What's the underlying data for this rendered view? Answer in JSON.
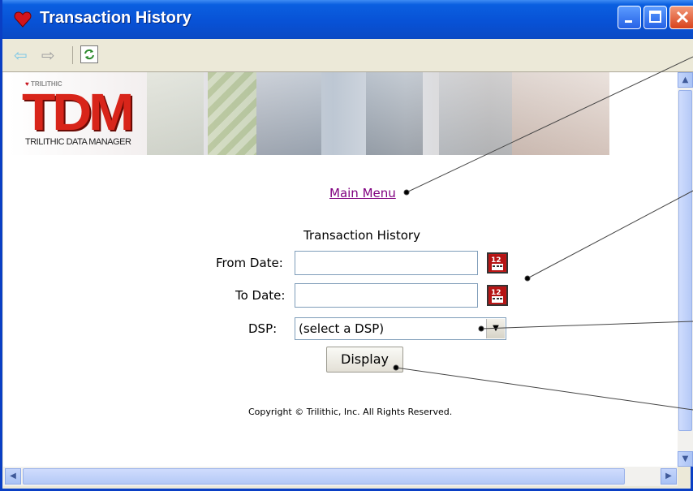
{
  "window": {
    "title": "Transaction History"
  },
  "toolbar": {
    "back": "⇦",
    "forward": "⇨"
  },
  "banner": {
    "brand_small": "TRILITHIC",
    "logo": "TDM",
    "logo_sub": "TRILITHIC DATA MANAGER"
  },
  "main": {
    "main_menu_link": "Main Menu",
    "form_title": "Transaction History",
    "from_label": "From Date:",
    "to_label": "To Date:",
    "dsp_label": "DSP:",
    "from_value": "",
    "to_value": "",
    "dsp_selected": "(select a DSP)",
    "display_button": "Display",
    "copyright": "Copyright © Trilithic, Inc. All Rights Reserved."
  },
  "colors": {
    "titlebar": "#0852d6",
    "link": "#800080",
    "logo": "#d8251a"
  },
  "icons": [
    "heart-app-icon",
    "back-arrow-icon",
    "forward-arrow-icon",
    "refresh-icon",
    "calendar-icon",
    "dropdown-arrow-icon"
  ]
}
